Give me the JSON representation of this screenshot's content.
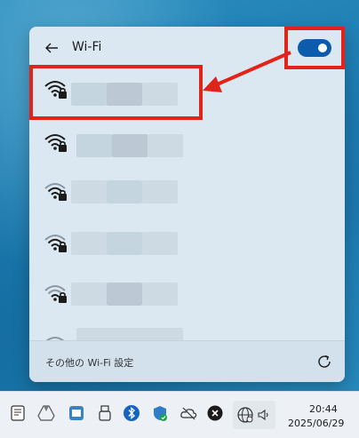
{
  "wifi_panel": {
    "title": "Wi-Fi",
    "wifi_enabled": true,
    "networks": [
      {
        "signal": "full",
        "secured": true
      },
      {
        "signal": "full",
        "secured": true
      },
      {
        "signal": "medium",
        "secured": true
      },
      {
        "signal": "medium",
        "secured": true
      },
      {
        "signal": "low",
        "secured": true
      },
      {
        "signal": "low",
        "secured": true
      }
    ],
    "footer_label": "その他の Wi-Fi 設定"
  },
  "taskbar": {
    "icons": [
      "notepad-icon",
      "google-drive-icon",
      "app-icon",
      "usb-icon",
      "bluetooth-icon",
      "defender-icon",
      "onedrive-icon",
      "close-app-icon"
    ],
    "time": "20:44",
    "date": "2025/06/29"
  },
  "colors": {
    "annotation": "#e2231a",
    "accent": "#0b5cad"
  }
}
